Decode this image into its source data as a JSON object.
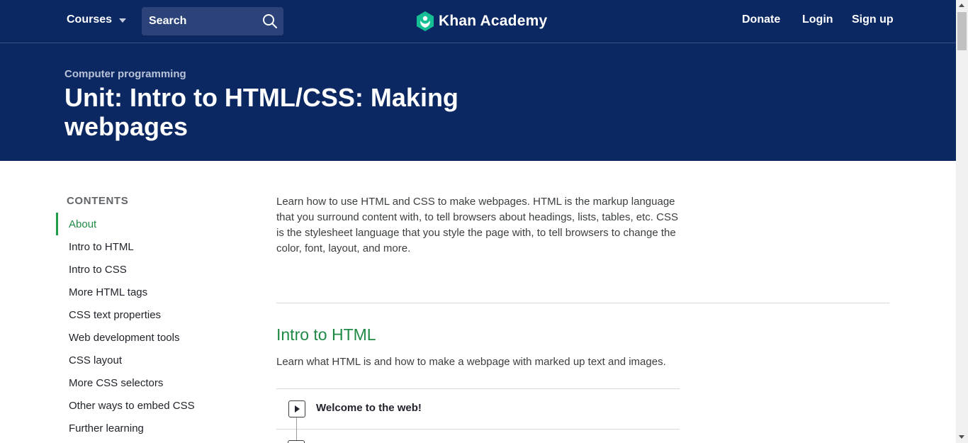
{
  "nav": {
    "courses_label": "Courses",
    "search_placeholder": "Search",
    "logo_text": "Khan Academy",
    "donate_label": "Donate",
    "login_label": "Login",
    "signup_label": "Sign up"
  },
  "header": {
    "breadcrumb": "Computer programming",
    "title": "Unit: Intro to HTML/CSS: Making webpages"
  },
  "sidebar": {
    "heading": "CONTENTS",
    "items": [
      {
        "label": "About"
      },
      {
        "label": "Intro to HTML"
      },
      {
        "label": "Intro to CSS"
      },
      {
        "label": "More HTML tags"
      },
      {
        "label": "CSS text properties"
      },
      {
        "label": "Web development tools"
      },
      {
        "label": "CSS layout"
      },
      {
        "label": "More CSS selectors"
      },
      {
        "label": "Other ways to embed CSS"
      },
      {
        "label": "Further learning"
      }
    ]
  },
  "main": {
    "intro": "Learn how to use HTML and CSS to make webpages. HTML is the markup language that you surround content with, to tell browsers about headings, lists, tables, etc. CSS is the stylesheet language that you style the page with, to tell browsers to change the color, font, layout, and more.",
    "section_title": "Intro to HTML",
    "section_desc": "Learn what HTML is and how to make a webpage with marked up text and images.",
    "lessons": [
      {
        "title": "Welcome to the web!"
      }
    ]
  },
  "colors": {
    "nav_bg": "#0b2862",
    "accent_green": "#1f8a46",
    "logo_green": "#14bf96"
  },
  "icons": [
    "caret-down-icon",
    "search-icon",
    "khan-logo-icon",
    "play-icon"
  ]
}
